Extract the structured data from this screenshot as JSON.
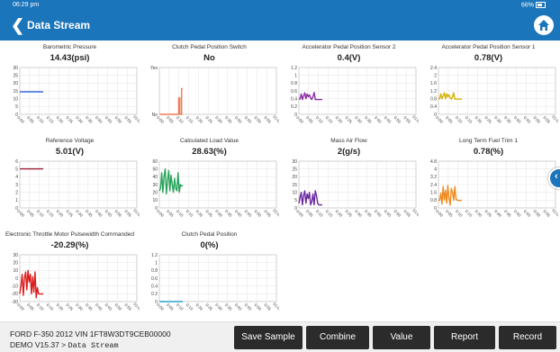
{
  "status_bar": {
    "time": "06:29 pm",
    "battery": "66%"
  },
  "header": {
    "back_icon": "chevron-left-icon",
    "title": "Data Stream",
    "home_icon": "home-icon"
  },
  "x_ticks": [
    "0:00",
    "0:05",
    "0:10",
    "0:15",
    "0:20",
    "0:25",
    "0:30",
    "0:35",
    "0:40",
    "0:45",
    "0:50",
    "0:55",
    "01:00"
  ],
  "chart_data": [
    {
      "type": "line",
      "title": "Barometric Pressure",
      "value": "14.43(psi)",
      "color": "#3a6bd6",
      "yticks": [
        "30",
        "25",
        "20",
        "15",
        "10",
        "5",
        "0"
      ],
      "ylim": [
        0,
        30
      ],
      "series": [
        {
          "x": [
            0,
            0.2
          ],
          "y": [
            14.43,
            14.43
          ]
        }
      ]
    },
    {
      "type": "line",
      "title": "Clutch Pedal Position Switch",
      "value": "No",
      "color": "#f07a57",
      "yticks": [
        "Yes",
        "No"
      ],
      "ylim": [
        0,
        1
      ],
      "series": [
        {
          "x": [
            0,
            0.165,
            0.165,
            0.175,
            0.175,
            0.19,
            0.19,
            0.2
          ],
          "y": [
            0,
            0,
            0.35,
            0.35,
            0,
            0,
            0.55,
            0.55
          ]
        }
      ]
    },
    {
      "type": "line",
      "title": "Accelerator Pedal Position Sensor 2",
      "value": "0.4(V)",
      "color": "#8b2aa3",
      "yticks": [
        "1.2",
        "1",
        "0.8",
        "0.6",
        "0.4",
        "0.2",
        "0"
      ],
      "ylim": [
        0,
        1.2
      ],
      "series": [
        {
          "x": [
            0,
            0.01,
            0.02,
            0.03,
            0.04,
            0.05,
            0.06,
            0.07,
            0.08,
            0.09,
            0.1,
            0.11,
            0.12,
            0.13,
            0.14,
            0.15,
            0.16,
            0.17,
            0.18,
            0.19,
            0.2
          ],
          "y": [
            0.38,
            0.4,
            0.52,
            0.38,
            0.47,
            0.55,
            0.4,
            0.52,
            0.45,
            0.5,
            0.42,
            0.38,
            0.45,
            0.56,
            0.38,
            0.38,
            0.38,
            0.38,
            0.38,
            0.38,
            0.38
          ]
        }
      ]
    },
    {
      "type": "line",
      "title": "Accelerator Pedal Position Sensor 1",
      "value": "0.78(V)",
      "color": "#d6b200",
      "yticks": [
        "2.4",
        "2",
        "1.6",
        "1.2",
        "0.8",
        "0.4",
        "0"
      ],
      "ylim": [
        0,
        2.4
      ],
      "series": [
        {
          "x": [
            0,
            0.01,
            0.02,
            0.03,
            0.04,
            0.05,
            0.06,
            0.07,
            0.08,
            0.09,
            0.1,
            0.11,
            0.12,
            0.13,
            0.14,
            0.15,
            0.16,
            0.17,
            0.18,
            0.19,
            0.2
          ],
          "y": [
            0.78,
            0.8,
            1.05,
            0.8,
            0.95,
            1.1,
            0.8,
            1.05,
            0.9,
            1.0,
            0.85,
            0.78,
            0.9,
            1.1,
            0.78,
            0.78,
            0.78,
            0.78,
            0.78,
            0.78,
            0.78
          ]
        }
      ]
    },
    {
      "type": "line",
      "title": "Reference Voltage",
      "value": "5.01(V)",
      "color": "#9b1b30",
      "yticks": [
        "6",
        "5",
        "4",
        "3",
        "2",
        "1",
        "0"
      ],
      "ylim": [
        0,
        6
      ],
      "series": [
        {
          "x": [
            0,
            0.2
          ],
          "y": [
            5.01,
            5.01
          ]
        }
      ]
    },
    {
      "type": "line",
      "title": "Calculated Load Value",
      "value": "28.63(%)",
      "color": "#27a35a",
      "yticks": [
        "60",
        "50",
        "40",
        "30",
        "20",
        "10",
        "0"
      ],
      "ylim": [
        0,
        60
      ],
      "series": [
        {
          "x": [
            0,
            0.01,
            0.02,
            0.03,
            0.04,
            0.05,
            0.06,
            0.07,
            0.08,
            0.09,
            0.1,
            0.11,
            0.12,
            0.13,
            0.14,
            0.15,
            0.16,
            0.17,
            0.18,
            0.19,
            0.2
          ],
          "y": [
            22,
            25,
            45,
            20,
            40,
            50,
            18,
            35,
            48,
            22,
            42,
            30,
            20,
            38,
            25,
            22,
            45,
            20,
            30,
            28,
            28.63
          ]
        }
      ]
    },
    {
      "type": "line",
      "title": "Mass Air Flow",
      "value": "2(g/s)",
      "color": "#6a2aa0",
      "yticks": [
        "30",
        "25",
        "20",
        "15",
        "10",
        "5",
        "0"
      ],
      "ylim": [
        0,
        30
      ],
      "series": [
        {
          "x": [
            0,
            0.01,
            0.02,
            0.03,
            0.04,
            0.05,
            0.06,
            0.07,
            0.08,
            0.09,
            0.1,
            0.11,
            0.12,
            0.13,
            0.14,
            0.15,
            0.16,
            0.17,
            0.18,
            0.19,
            0.2
          ],
          "y": [
            3,
            7,
            10,
            2,
            8,
            11,
            3,
            9,
            6,
            10,
            2,
            4,
            9,
            2,
            11,
            8,
            3,
            2,
            2,
            2,
            2
          ]
        }
      ]
    },
    {
      "type": "line",
      "title": "Long Term Fuel Trim 1",
      "value": "0.78(%)",
      "color": "#f08a1e",
      "yticks": [
        "4.8",
        "4",
        "3.2",
        "2.4",
        "1.6",
        "0.8",
        "0"
      ],
      "ylim": [
        0,
        4.8
      ],
      "series": [
        {
          "x": [
            0,
            0.01,
            0.02,
            0.03,
            0.04,
            0.05,
            0.06,
            0.07,
            0.08,
            0.09,
            0.1,
            0.11,
            0.12,
            0.13,
            0.14,
            0.15,
            0.16,
            0.17,
            0.18,
            0.19,
            0.2
          ],
          "y": [
            0.78,
            0.78,
            1.5,
            0.4,
            2.2,
            0.8,
            1.8,
            0.5,
            2.3,
            1.0,
            0.3,
            2.0,
            1.6,
            0.78,
            2.2,
            0.9,
            0.78,
            0.78,
            0.78,
            0.78,
            0.78
          ]
        }
      ]
    },
    {
      "type": "line",
      "title": "Electronic Throttle Motor Pulsewidth Commanded",
      "value": "-20.29(%)",
      "color": "#dd1c1c",
      "yticks": [
        "30",
        "20",
        "10",
        "0",
        "-10",
        "-20",
        "-30"
      ],
      "ylim": [
        -30,
        30
      ],
      "series": [
        {
          "x": [
            0,
            0.01,
            0.02,
            0.03,
            0.04,
            0.05,
            0.06,
            0.07,
            0.08,
            0.09,
            0.1,
            0.11,
            0.12,
            0.13,
            0.14,
            0.15,
            0.16,
            0.17,
            0.18,
            0.19,
            0.2
          ],
          "y": [
            -20,
            -10,
            5,
            -22,
            0,
            8,
            -15,
            10,
            -5,
            5,
            -20,
            2,
            -18,
            8,
            -25,
            -12,
            -20,
            -20.29,
            -20.29,
            -20.29,
            -20.29
          ]
        }
      ]
    },
    {
      "type": "line",
      "title": "Clutch Pedal Position",
      "value": "0(%)",
      "color": "#2aa3c7",
      "yticks": [
        "1.2",
        "1",
        "0.8",
        "0.6",
        "0.4",
        "0.2",
        "0"
      ],
      "ylim": [
        0,
        1.2
      ],
      "series": [
        {
          "x": [
            0,
            0.2
          ],
          "y": [
            0,
            0
          ]
        }
      ]
    }
  ],
  "footer": {
    "vehicle": "FORD  F-350  2012  VIN  1FT8W3DT9CEB00000",
    "path_prefix": "DEMO V15.37 > ",
    "path_title": "Data Stream",
    "buttons": [
      "Save Sample",
      "Combine",
      "Value",
      "Report",
      "Record"
    ]
  }
}
